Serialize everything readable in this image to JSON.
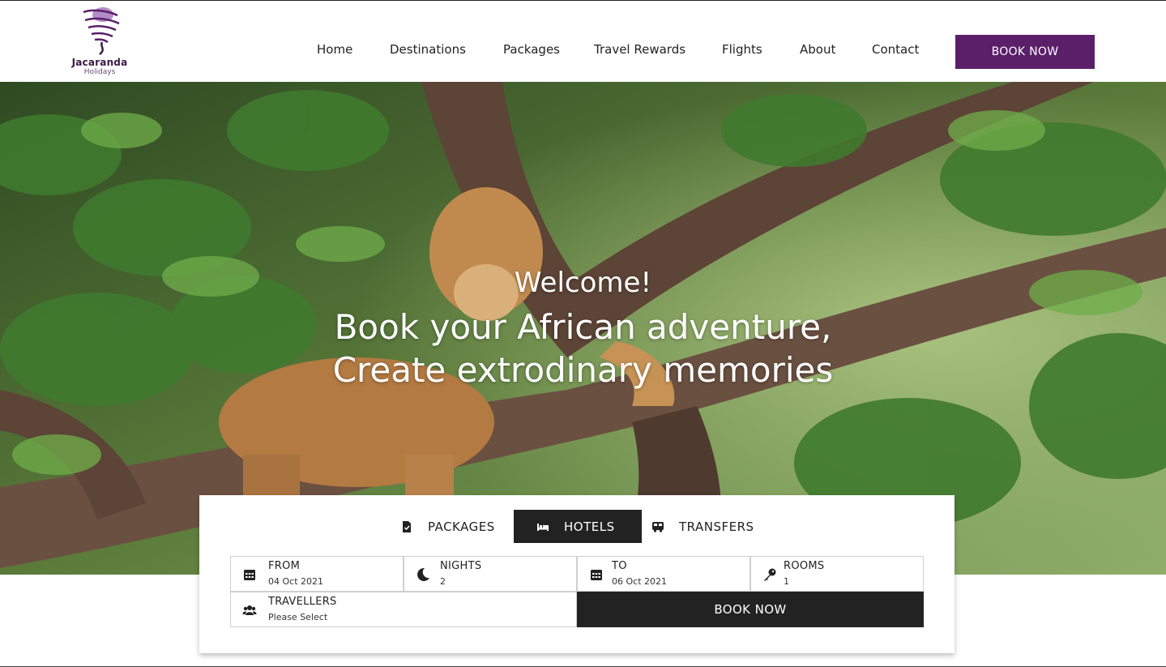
{
  "logo": {
    "name": "Jacaranda",
    "sub": "Holidays"
  },
  "nav": {
    "items": [
      "Home",
      "Destinations",
      "Packages",
      "Travel Rewards",
      "Flights",
      "About",
      "Contact"
    ],
    "book_label": "BOOK NOW"
  },
  "colors": {
    "brand": "#5b1f6a",
    "dark": "#222222"
  },
  "hero": {
    "welcome": "Welcome!",
    "line1": "Book your African adventure,",
    "line2": "Create extrodinary memories"
  },
  "booking": {
    "tabs": [
      {
        "label": "PACKAGES",
        "icon": "document-icon",
        "active": false
      },
      {
        "label": "HOTELS",
        "icon": "bed-icon",
        "active": true
      },
      {
        "label": "TRANSFERS",
        "icon": "bus-icon",
        "active": false
      }
    ],
    "from": {
      "label": "FROM",
      "value": "04 Oct 2021",
      "icon": "calendar-icon"
    },
    "nights": {
      "label": "NIGHTS",
      "value": "2",
      "icon": "moon-icon"
    },
    "to": {
      "label": "TO",
      "value": "06 Oct 2021",
      "icon": "calendar-icon"
    },
    "rooms": {
      "label": "ROOMS",
      "value": "1",
      "icon": "key-icon"
    },
    "travellers": {
      "label": "TRAVELLERS",
      "value": "Please Select",
      "icon": "users-icon"
    },
    "book_label": "BOOK NOW"
  }
}
